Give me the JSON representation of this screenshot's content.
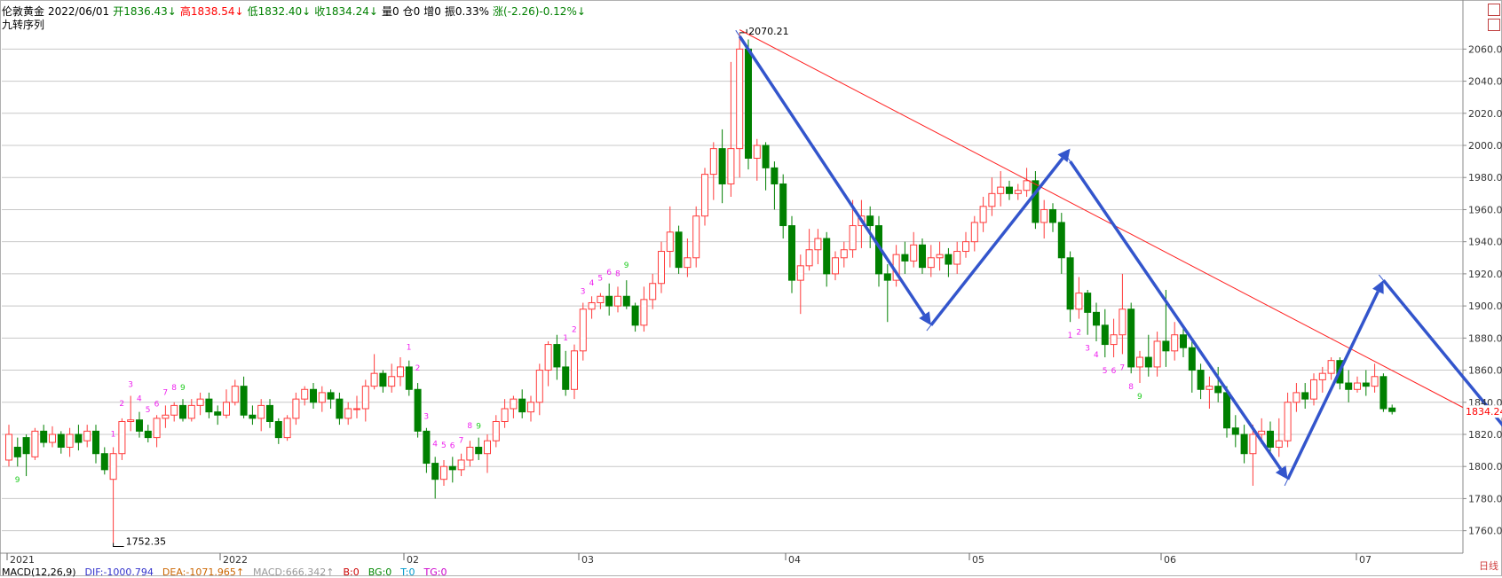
{
  "header": {
    "instrument": "伦敦黄金",
    "date": "2022/06/01",
    "open": "开1836.43↓",
    "high": "高1838.54↓",
    "low": "低1832.40↓",
    "close": "收1834.24↓",
    "volume": "量0",
    "open_interest": "仓0",
    "increase": "增0",
    "amplitude": "振0.33%",
    "change": "涨(-2.26)-0.12%↓",
    "indicator": "九转序列"
  },
  "macd_bar": {
    "label": "MACD(12,26,9)",
    "dif": "DIF:-1000.794",
    "dea": "DEA:-1071.965↑",
    "macd": "MACD:666.342↑",
    "b": "B:0",
    "bg": "BG:0",
    "t": "T:0",
    "tg": "TG:0"
  },
  "period_label": "日线",
  "colors": {
    "up": "#ff3b3b",
    "down": "#008000",
    "trend_line": "#ff2020",
    "arrow": "#3355cc",
    "grid": "#c8c8c8",
    "nine_up": "#ee22ee",
    "nine_green": "#22cc22",
    "last_price": "#ff0000"
  },
  "chart_data": {
    "type": "candlestick",
    "y_ticks": [
      1760,
      1780,
      1800,
      1820,
      1840,
      1860,
      1880,
      1900,
      1920,
      1940,
      1960,
      1980,
      2000,
      2020,
      2040,
      2060
    ],
    "ylim": [
      1746,
      2074
    ],
    "x_labels": [
      "2021",
      "2022",
      "02",
      "03",
      "04",
      "05",
      "06",
      "07"
    ],
    "last_price": "1834.24",
    "high_label": "2070.21",
    "low_label": "1752.35",
    "candles": [
      [
        1804,
        1820,
        1800,
        1826
      ],
      [
        1812,
        1806,
        1800,
        1818
      ],
      [
        1818,
        1808,
        1794,
        1820
      ],
      [
        1806,
        1822,
        1804,
        1824
      ],
      [
        1822,
        1815,
        1812,
        1826
      ],
      [
        1815,
        1820,
        1812,
        1825
      ],
      [
        1820,
        1812,
        1808,
        1822
      ],
      [
        1812,
        1820,
        1806,
        1824
      ],
      [
        1820,
        1815,
        1810,
        1826
      ],
      [
        1816,
        1822,
        1812,
        1826
      ],
      [
        1822,
        1808,
        1802,
        1826
      ],
      [
        1808,
        1798,
        1795,
        1812
      ],
      [
        1792,
        1808,
        1752.35,
        1812
      ],
      [
        1808,
        1828,
        1804,
        1830
      ],
      [
        1828,
        1829,
        1822,
        1844
      ],
      [
        1829,
        1822,
        1818,
        1834
      ],
      [
        1822,
        1818,
        1815,
        1826
      ],
      [
        1818,
        1830,
        1812,
        1832
      ],
      [
        1830,
        1832,
        1824,
        1838
      ],
      [
        1832,
        1838,
        1828,
        1840
      ],
      [
        1838,
        1830,
        1828,
        1842
      ],
      [
        1830,
        1838,
        1828,
        1842
      ],
      [
        1838,
        1842,
        1832,
        1846
      ],
      [
        1842,
        1834,
        1830,
        1846
      ],
      [
        1834,
        1832,
        1826,
        1838
      ],
      [
        1832,
        1840,
        1830,
        1848
      ],
      [
        1840,
        1850,
        1838,
        1854
      ],
      [
        1850,
        1832,
        1830,
        1856
      ],
      [
        1832,
        1830,
        1826,
        1838
      ],
      [
        1830,
        1838,
        1822,
        1842
      ],
      [
        1838,
        1828,
        1824,
        1842
      ],
      [
        1828,
        1818,
        1814,
        1830
      ],
      [
        1818,
        1830,
        1816,
        1832
      ],
      [
        1830,
        1842,
        1826,
        1846
      ],
      [
        1842,
        1848,
        1838,
        1850
      ],
      [
        1848,
        1840,
        1836,
        1852
      ],
      [
        1840,
        1846,
        1834,
        1850
      ],
      [
        1846,
        1842,
        1836,
        1848
      ],
      [
        1842,
        1830,
        1826,
        1846
      ],
      [
        1830,
        1836,
        1826,
        1840
      ],
      [
        1836,
        1836,
        1830,
        1844
      ],
      [
        1836,
        1850,
        1828,
        1854
      ],
      [
        1850,
        1858,
        1848,
        1870
      ],
      [
        1858,
        1850,
        1846,
        1860
      ],
      [
        1850,
        1856,
        1846,
        1864
      ],
      [
        1856,
        1862,
        1850,
        1868
      ],
      [
        1862,
        1848,
        1844,
        1866
      ],
      [
        1848,
        1822,
        1818,
        1852
      ],
      [
        1822,
        1802,
        1796,
        1824
      ],
      [
        1802,
        1792,
        1780,
        1806
      ],
      [
        1792,
        1800,
        1788,
        1804
      ],
      [
        1800,
        1798,
        1790,
        1806
      ],
      [
        1798,
        1804,
        1794,
        1808
      ],
      [
        1804,
        1812,
        1800,
        1816
      ],
      [
        1812,
        1808,
        1804,
        1818
      ],
      [
        1808,
        1816,
        1796,
        1820
      ],
      [
        1816,
        1828,
        1812,
        1832
      ],
      [
        1828,
        1836,
        1824,
        1842
      ],
      [
        1836,
        1842,
        1830,
        1844
      ],
      [
        1842,
        1834,
        1830,
        1848
      ],
      [
        1834,
        1840,
        1828,
        1844
      ],
      [
        1840,
        1860,
        1832,
        1864
      ],
      [
        1860,
        1876,
        1850,
        1878
      ],
      [
        1876,
        1862,
        1854,
        1882
      ],
      [
        1862,
        1848,
        1844,
        1872
      ],
      [
        1848,
        1872,
        1842,
        1876
      ],
      [
        1872,
        1898,
        1866,
        1902
      ],
      [
        1898,
        1902,
        1892,
        1906
      ],
      [
        1902,
        1906,
        1898,
        1908
      ],
      [
        1906,
        1900,
        1894,
        1914
      ],
      [
        1900,
        1906,
        1896,
        1912
      ],
      [
        1906,
        1900,
        1898,
        1916
      ],
      [
        1900,
        1888,
        1884,
        1902
      ],
      [
        1888,
        1904,
        1884,
        1912
      ],
      [
        1904,
        1914,
        1898,
        1920
      ],
      [
        1914,
        1934,
        1908,
        1940
      ],
      [
        1934,
        1946,
        1924,
        1962
      ],
      [
        1946,
        1924,
        1920,
        1950
      ],
      [
        1924,
        1930,
        1918,
        1942
      ],
      [
        1930,
        1956,
        1924,
        1962
      ],
      [
        1956,
        1982,
        1950,
        1986
      ],
      [
        1982,
        1998,
        1966,
        2002
      ],
      [
        1998,
        1976,
        1964,
        2010
      ],
      [
        1976,
        1998,
        1968,
        2052
      ],
      [
        1998,
        2060,
        1980,
        2070.21
      ],
      [
        2060,
        1992,
        1985,
        2066
      ],
      [
        1992,
        2000,
        1978,
        2004
      ],
      [
        2000,
        1986,
        1972,
        2002
      ],
      [
        1986,
        1976,
        1960,
        1990
      ],
      [
        1976,
        1950,
        1942,
        1982
      ],
      [
        1950,
        1916,
        1908,
        1956
      ],
      [
        1916,
        1925,
        1895,
        1932
      ],
      [
        1925,
        1935,
        1922,
        1948
      ],
      [
        1935,
        1942,
        1926,
        1948
      ],
      [
        1942,
        1920,
        1912,
        1946
      ],
      [
        1920,
        1930,
        1916,
        1934
      ],
      [
        1930,
        1935,
        1924,
        1940
      ],
      [
        1935,
        1950,
        1930,
        1966
      ],
      [
        1950,
        1956,
        1936,
        1966
      ],
      [
        1956,
        1950,
        1936,
        1962
      ],
      [
        1950,
        1920,
        1912,
        1956
      ],
      [
        1920,
        1916,
        1890,
        1926
      ],
      [
        1916,
        1932,
        1912,
        1938
      ],
      [
        1932,
        1928,
        1920,
        1940
      ],
      [
        1928,
        1938,
        1924,
        1946
      ],
      [
        1938,
        1924,
        1920,
        1942
      ],
      [
        1924,
        1930,
        1918,
        1938
      ],
      [
        1930,
        1932,
        1922,
        1940
      ],
      [
        1932,
        1926,
        1918,
        1936
      ],
      [
        1926,
        1934,
        1920,
        1940
      ],
      [
        1934,
        1940,
        1930,
        1946
      ],
      [
        1940,
        1952,
        1934,
        1956
      ],
      [
        1952,
        1962,
        1946,
        1968
      ],
      [
        1962,
        1970,
        1956,
        1980
      ],
      [
        1970,
        1974,
        1962,
        1984
      ],
      [
        1974,
        1970,
        1966,
        1978
      ],
      [
        1970,
        1972,
        1966,
        1976
      ],
      [
        1972,
        1978,
        1968,
        1986
      ],
      [
        1978,
        1952,
        1948,
        1984
      ],
      [
        1952,
        1960,
        1942,
        1966
      ],
      [
        1960,
        1952,
        1946,
        1964
      ],
      [
        1952,
        1930,
        1920,
        1958
      ],
      [
        1930,
        1898,
        1890,
        1934
      ],
      [
        1898,
        1908,
        1892,
        1918
      ],
      [
        1908,
        1896,
        1882,
        1910
      ],
      [
        1896,
        1888,
        1878,
        1902
      ],
      [
        1888,
        1876,
        1868,
        1898
      ],
      [
        1876,
        1882,
        1868,
        1892
      ],
      [
        1882,
        1898,
        1870,
        1920
      ],
      [
        1898,
        1862,
        1858,
        1902
      ],
      [
        1862,
        1868,
        1852,
        1872
      ],
      [
        1868,
        1862,
        1856,
        1882
      ],
      [
        1862,
        1878,
        1856,
        1884
      ],
      [
        1878,
        1872,
        1862,
        1910
      ],
      [
        1872,
        1882,
        1866,
        1890
      ],
      [
        1882,
        1874,
        1868,
        1886
      ],
      [
        1874,
        1860,
        1846,
        1878
      ],
      [
        1860,
        1848,
        1842,
        1864
      ],
      [
        1848,
        1850,
        1836,
        1856
      ],
      [
        1850,
        1846,
        1840,
        1862
      ],
      [
        1846,
        1824,
        1818,
        1850
      ],
      [
        1824,
        1820,
        1812,
        1832
      ],
      [
        1820,
        1808,
        1802,
        1826
      ],
      [
        1808,
        1820,
        1788,
        1826
      ],
      [
        1820,
        1822,
        1814,
        1830
      ],
      [
        1822,
        1812,
        1808,
        1828
      ],
      [
        1812,
        1816,
        1806,
        1830
      ],
      [
        1816,
        1840,
        1812,
        1846
      ],
      [
        1840,
        1846,
        1834,
        1852
      ],
      [
        1846,
        1842,
        1836,
        1852
      ],
      [
        1842,
        1854,
        1838,
        1858
      ],
      [
        1854,
        1858,
        1846,
        1862
      ],
      [
        1858,
        1866,
        1854,
        1868
      ],
      [
        1866,
        1852,
        1848,
        1868
      ],
      [
        1852,
        1848,
        1840,
        1860
      ],
      [
        1848,
        1852,
        1846,
        1856
      ],
      [
        1852,
        1850,
        1844,
        1860
      ],
      [
        1850,
        1856,
        1846,
        1864
      ],
      [
        1856,
        1836,
        1834,
        1858
      ],
      [
        1836.43,
        1834.24,
        1832.4,
        1838.54
      ]
    ],
    "nine_marks": [
      {
        "i": 1,
        "t": "9",
        "pos": "below",
        "c": "g"
      },
      {
        "i": 12,
        "t": "1",
        "pos": "above",
        "c": "m"
      },
      {
        "i": 13,
        "t": "2",
        "pos": "above",
        "c": "m"
      },
      {
        "i": 14,
        "t": "3",
        "pos": "above",
        "c": "m"
      },
      {
        "i": 15,
        "t": "4",
        "pos": "above",
        "c": "m"
      },
      {
        "i": 16,
        "t": "5",
        "pos": "above",
        "c": "m"
      },
      {
        "i": 17,
        "t": "6",
        "pos": "above",
        "c": "m"
      },
      {
        "i": 18,
        "t": "7",
        "pos": "above",
        "c": "m"
      },
      {
        "i": 19,
        "t": "8",
        "pos": "above",
        "c": "m"
      },
      {
        "i": 20,
        "t": "9",
        "pos": "above",
        "c": "g"
      },
      {
        "i": 46,
        "t": "1",
        "pos": "above",
        "c": "m"
      },
      {
        "i": 47,
        "t": "2",
        "pos": "above",
        "c": "m"
      },
      {
        "i": 48,
        "t": "3",
        "pos": "above",
        "c": "m"
      },
      {
        "i": 49,
        "t": "4",
        "pos": "above",
        "c": "m"
      },
      {
        "i": 50,
        "t": "5",
        "pos": "above",
        "c": "m"
      },
      {
        "i": 51,
        "t": "6",
        "pos": "above",
        "c": "m"
      },
      {
        "i": 52,
        "t": "7",
        "pos": "above",
        "c": "m"
      },
      {
        "i": 53,
        "t": "8",
        "pos": "above",
        "c": "m"
      },
      {
        "i": 54,
        "t": "9",
        "pos": "above",
        "c": "g"
      },
      {
        "i": 64,
        "t": "1",
        "pos": "above",
        "c": "m"
      },
      {
        "i": 65,
        "t": "2",
        "pos": "above",
        "c": "m"
      },
      {
        "i": 66,
        "t": "3",
        "pos": "above",
        "c": "m"
      },
      {
        "i": 67,
        "t": "4",
        "pos": "above",
        "c": "m"
      },
      {
        "i": 68,
        "t": "5",
        "pos": "above",
        "c": "m"
      },
      {
        "i": 69,
        "t": "6",
        "pos": "above",
        "c": "m"
      },
      {
        "i": 70,
        "t": "8",
        "pos": "above",
        "c": "m"
      },
      {
        "i": 71,
        "t": "9",
        "pos": "above",
        "c": "g"
      },
      {
        "i": 122,
        "t": "1",
        "pos": "below",
        "c": "m"
      },
      {
        "i": 123,
        "t": "2",
        "pos": "below",
        "c": "m"
      },
      {
        "i": 124,
        "t": "3",
        "pos": "below",
        "c": "m"
      },
      {
        "i": 125,
        "t": "4",
        "pos": "below",
        "c": "m"
      },
      {
        "i": 126,
        "t": "5",
        "pos": "below",
        "c": "m"
      },
      {
        "i": 127,
        "t": "6",
        "pos": "below",
        "c": "m"
      },
      {
        "i": 128,
        "t": "7",
        "pos": "below",
        "c": "m"
      },
      {
        "i": 129,
        "t": "8",
        "pos": "below",
        "c": "m"
      },
      {
        "i": 130,
        "t": "9",
        "pos": "below",
        "c": "g"
      }
    ],
    "trend_line": [
      [
        84,
        2072
      ],
      [
        166,
        1840
      ]
    ],
    "arrows": [
      [
        [
          84,
          2068
        ],
        [
          106,
          1888
        ]
      ],
      [
        [
          106,
          1888
        ],
        [
          122,
          1998
        ]
      ],
      [
        [
          122,
          1990
        ],
        [
          147,
          1792
        ]
      ],
      [
        [
          147,
          1792
        ],
        [
          158,
          1916
        ]
      ],
      [
        [
          158,
          1916
        ],
        [
          182,
          1758
        ]
      ]
    ]
  }
}
